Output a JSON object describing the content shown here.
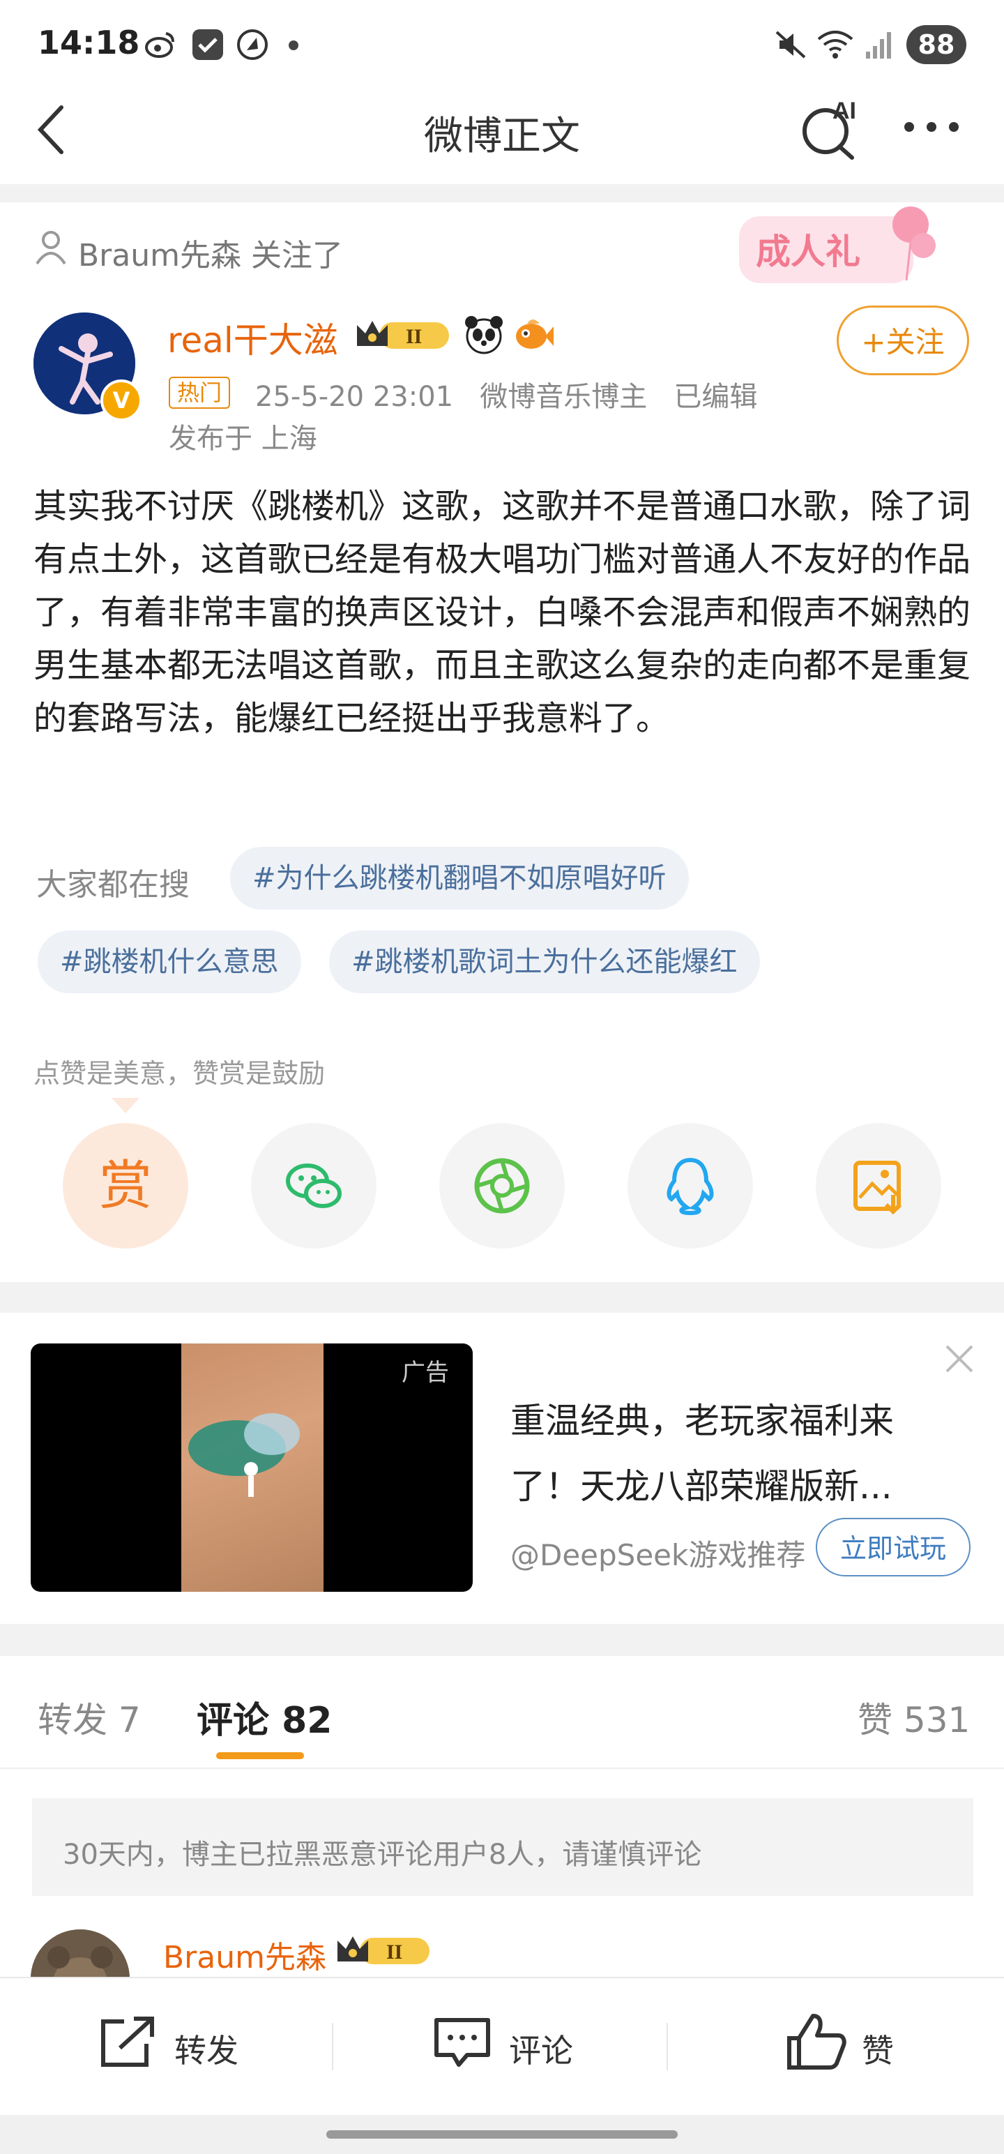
{
  "status_bar": {
    "time": "14:18",
    "battery": "88"
  },
  "nav": {
    "title": "微博正文",
    "ai_badge": "AI"
  },
  "post": {
    "follow_hint": "Braum先森 关注了",
    "banner_text": "成人礼",
    "author": "real干大滋",
    "crown_level": "II",
    "follow_button": "+关注",
    "hot_tag": "热门",
    "meta": "25-5-20 23:01   微博音乐博主   已编辑",
    "location": "发布于 上海",
    "content": "其实我不讨厌《跳楼机》这歌，这歌并不是普通口水歌，除了词有点土外，这首歌已经是有极大唱功门槛对普通人不友好的作品了，有着非常丰富的换声区设计，白嗓不会混声和假声不娴熟的男生基本都无法唱这首歌，而且主歌这么复杂的走向都不是重复的套路写法，能爆红已经挺出乎我意料了。",
    "search_label": "大家都在搜",
    "search_chips": [
      "#为什么跳楼机翻唱不如原唱好听",
      "#跳楼机什么意思",
      "#跳楼机歌词土为什么还能爆红"
    ],
    "praise_text": "点赞是美意，赞赏是鼓励",
    "reward_label": "赏"
  },
  "ad": {
    "label": "广告",
    "title": "重温经典，老玩家福利来了！天龙八部荣耀版新...",
    "source": "@DeepSeek游戏推荐",
    "button": "立即试玩"
  },
  "tabs": {
    "repost": "转发 7",
    "comment": "评论 82",
    "like": "赞 531"
  },
  "notice": "30天内，博主已拉黑恶意评论用户8人，请谨慎评论",
  "comment": {
    "author": "Braum先森",
    "crown_level": "II"
  },
  "bottom_bar": {
    "repost": "转发",
    "comment": "评论",
    "like": "赞"
  },
  "colors": {
    "accent_orange": "#e8640c",
    "link_blue": "#4a6f9c",
    "wechat_green": "#2dbb6c",
    "qq_blue": "#22a7f0"
  }
}
